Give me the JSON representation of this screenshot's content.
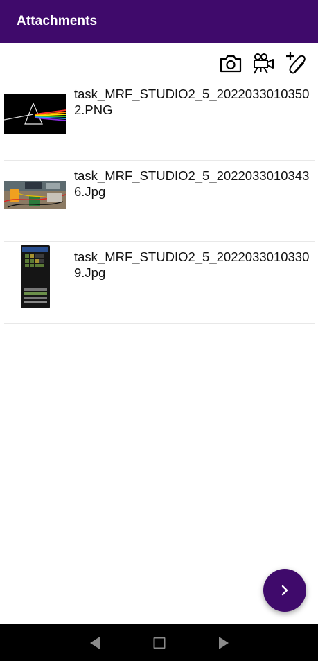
{
  "header": {
    "title": "Attachments"
  },
  "toolbar": {
    "items": [
      {
        "icon": "camera-icon"
      },
      {
        "icon": "video-camera-icon"
      },
      {
        "icon": "attach-file-icon"
      }
    ]
  },
  "attachments": [
    {
      "filename": "task_MRF_STUDIO2_5_20220330103502.PNG",
      "thumb": "prism-image"
    },
    {
      "filename": "task_MRF_STUDIO2_5_20220330103436.Jpg",
      "thumb": "workbench-photo"
    },
    {
      "filename": "task_MRF_STUDIO2_5_20220330103309.Jpg",
      "thumb": "phone-screenshot"
    }
  ],
  "fab": {
    "icon": "chevron-right-icon"
  },
  "navigation": {
    "back": "back-icon",
    "recents": "recents-icon",
    "forward": "forward-icon"
  },
  "colors": {
    "primary": "#3f0a6b",
    "navbar": "#000000"
  }
}
